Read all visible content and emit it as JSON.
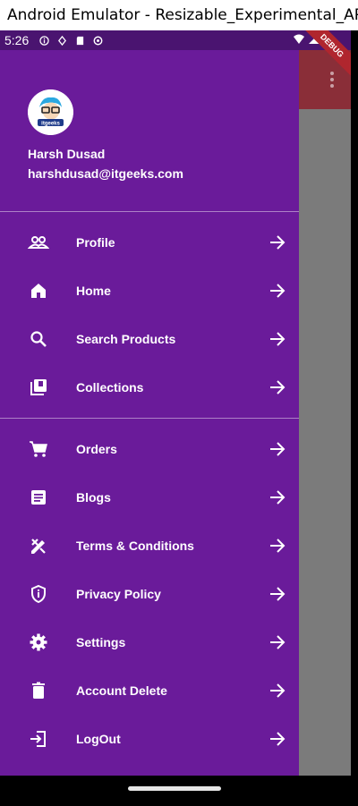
{
  "window": {
    "title": "Android Emulator - Resizable_Experimental_API..."
  },
  "status_bar": {
    "time": "5:26"
  },
  "debug_banner": {
    "label": "DEBUG"
  },
  "user": {
    "name": "Harsh Dusad",
    "email": "harshdusad@itgeeks.com",
    "avatar_label": "itgeeks"
  },
  "menu": {
    "group1": [
      {
        "label": "Profile",
        "icon": "people-icon"
      },
      {
        "label": "Home",
        "icon": "home-icon"
      },
      {
        "label": "Search Products",
        "icon": "search-icon"
      },
      {
        "label": "Collections",
        "icon": "collections-icon"
      }
    ],
    "group2": [
      {
        "label": "Orders",
        "icon": "cart-icon"
      },
      {
        "label": "Blogs",
        "icon": "article-icon"
      },
      {
        "label": "Terms & Conditions",
        "icon": "design-icon"
      },
      {
        "label": "Privacy Policy",
        "icon": "shield-icon"
      },
      {
        "label": "Settings",
        "icon": "gear-icon"
      },
      {
        "label": "Account Delete",
        "icon": "trash-icon"
      },
      {
        "label": "LogOut",
        "icon": "logout-icon"
      }
    ]
  },
  "colors": {
    "drawer": "#6a1b9a",
    "status_bar": "#4a1470",
    "scrim": "#7b7b7b",
    "appbar": "#8a2e38"
  }
}
